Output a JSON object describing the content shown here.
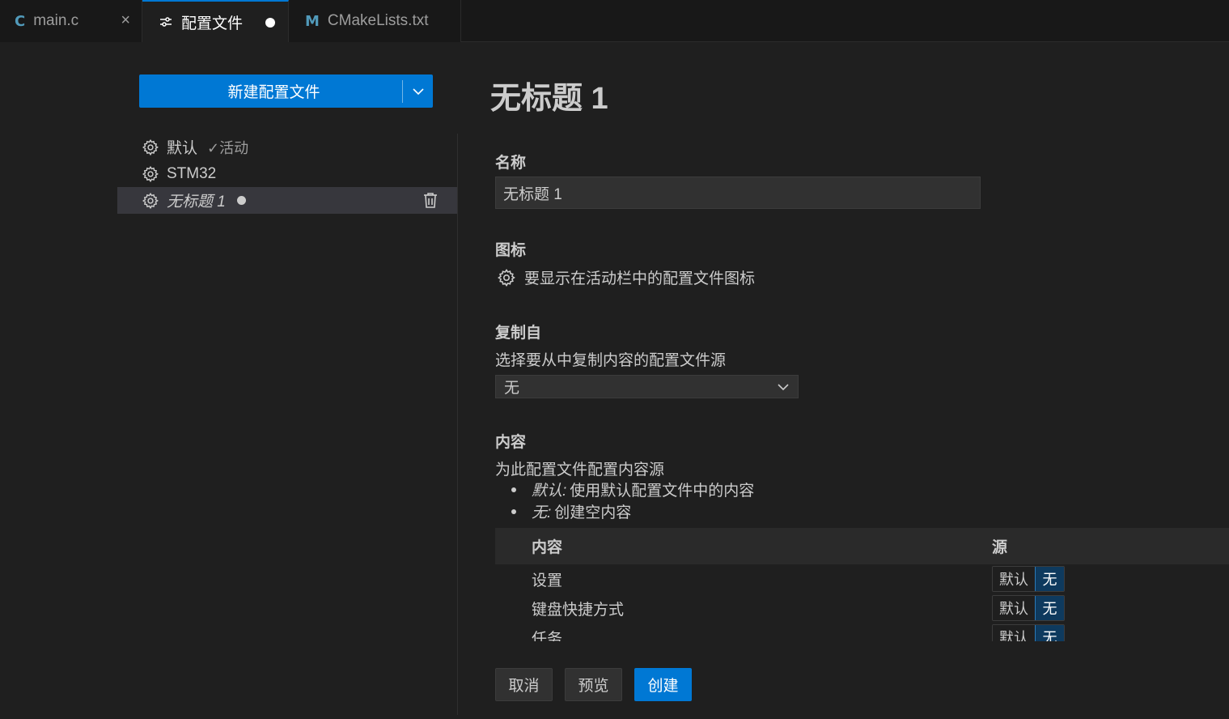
{
  "tabs": [
    {
      "icon": "C",
      "label": "main.c",
      "close": "×"
    },
    {
      "icon": "profile-settings-icon",
      "label": "配置文件"
    },
    {
      "icon": "M",
      "label": "CMakeLists.txt"
    }
  ],
  "sidebar": {
    "new_button_label": "新建配置文件",
    "profiles": [
      {
        "name": "默认",
        "active_label": "✓活动"
      },
      {
        "name": "STM32"
      },
      {
        "name": "无标题 1"
      }
    ]
  },
  "main": {
    "title": "无标题 1",
    "name_section": {
      "heading": "名称",
      "value": "无标题 1"
    },
    "icon_section": {
      "heading": "图标",
      "description": "要显示在活动栏中的配置文件图标"
    },
    "copy_section": {
      "heading": "复制自",
      "description": "选择要从中复制内容的配置文件源",
      "selected": "无"
    },
    "contents_section": {
      "heading": "内容",
      "description": "为此配置文件配置内容源",
      "bullets": [
        {
          "term": "默认:",
          "text": "使用默认配置文件中的内容"
        },
        {
          "term": "无:",
          "text": "创建空内容"
        }
      ],
      "table": {
        "col_content": "内容",
        "col_source": "源",
        "rows": [
          {
            "label": "设置",
            "opt_default": "默认",
            "opt_none": "无"
          },
          {
            "label": "键盘快捷方式",
            "opt_default": "默认",
            "opt_none": "无"
          },
          {
            "label": "任务",
            "opt_default": "默认",
            "opt_none": "无"
          }
        ]
      }
    }
  },
  "footer": {
    "cancel": "取消",
    "preview": "预览",
    "create": "创建"
  },
  "colors": {
    "accent": "#0078d4",
    "background": "#1f1f1f",
    "selected_item": "#37373d"
  }
}
